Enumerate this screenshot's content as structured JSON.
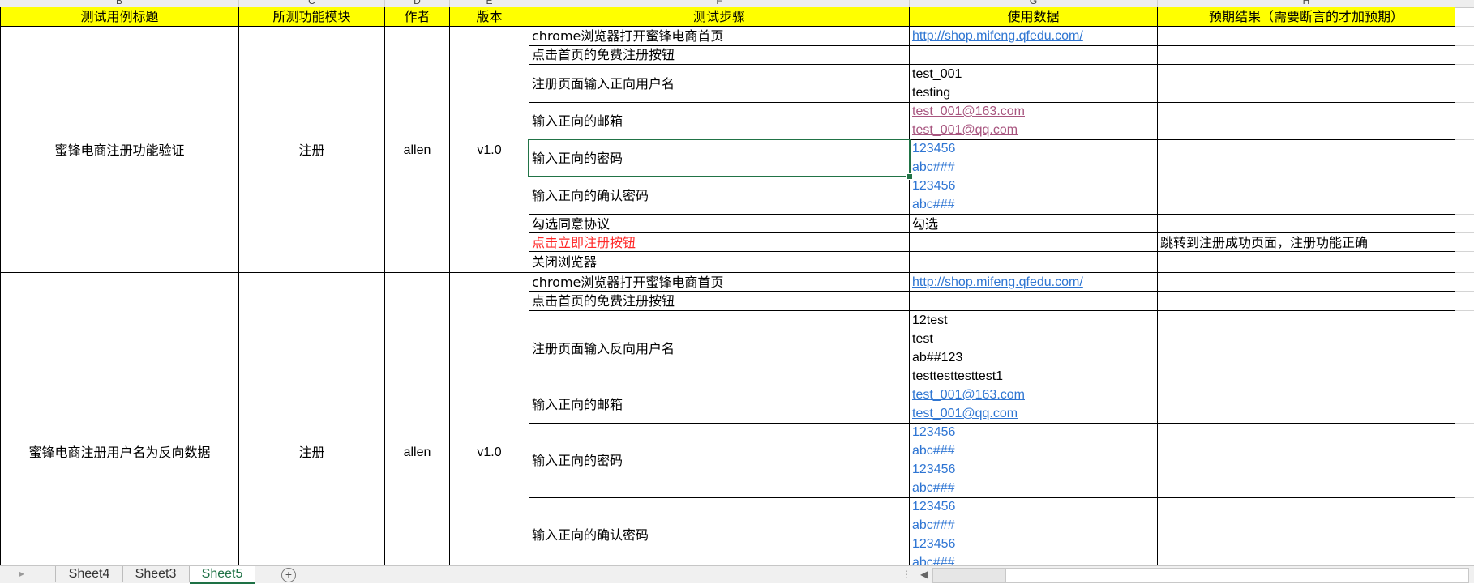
{
  "sheet": {
    "column_letters": [
      "B",
      "C",
      "D",
      "E",
      "F",
      "G",
      "H"
    ],
    "headers": {
      "title": "测试用例标题",
      "module": "所测功能模块",
      "author": "作者",
      "version": "版本",
      "steps": "测试步骤",
      "data": "使用数据",
      "expected": "预期结果（需要断言的才加预期）"
    },
    "case1": {
      "title": "蜜锋电商注册功能验证",
      "module": "注册",
      "author": "allen",
      "version": "v1.0",
      "steps": [
        "chrome浏览器打开蜜锋电商首页",
        "点击首页的免费注册按钮",
        "注册页面输入正向用户名",
        "输入正向的邮箱",
        "输入正向的密码",
        "输入正向的确认密码",
        "勾选同意协议",
        "点击立即注册按钮",
        "关闭浏览器"
      ],
      "data": {
        "url": "http://shop.mifeng.qfedu.com/",
        "username": [
          "test_001",
          "testing"
        ],
        "email": [
          "test_001@163.com",
          "test_001@qq.com"
        ],
        "password": [
          "123456",
          "abc###"
        ],
        "confirm": [
          "123456",
          "abc###"
        ],
        "agree": "勾选"
      },
      "expected": "跳转到注册成功页面，注册功能正确"
    },
    "case2": {
      "title": "蜜锋电商注册用户名为反向数据",
      "module": "注册",
      "author": "allen",
      "version": "v1.0",
      "steps": [
        "chrome浏览器打开蜜锋电商首页",
        "点击首页的免费注册按钮",
        "注册页面输入反向用户名",
        "输入正向的邮箱",
        "输入正向的密码",
        "输入正向的确认密码"
      ],
      "data": {
        "url": "http://shop.mifeng.qfedu.com/",
        "username": [
          "12test",
          "test",
          "ab##123",
          "testtesttesttest1"
        ],
        "email": [
          "test_001@163.com",
          "test_001@qq.com"
        ],
        "password": [
          "123456",
          "abc###",
          "123456",
          "abc###"
        ],
        "confirm": [
          "123456",
          "abc###",
          "123456",
          "abc###"
        ]
      }
    }
  },
  "tabs": [
    "Sheet4",
    "Sheet3",
    "Sheet5"
  ],
  "active_tab": "Sheet5",
  "add_sheet_icon": "plus-circle-icon",
  "colors": {
    "header_fill": "#ffff00",
    "active_tab": "#1e7145",
    "link": "#2f76d2",
    "visited_link": "#a8557f",
    "highlight_text": "#ff2a2a"
  }
}
